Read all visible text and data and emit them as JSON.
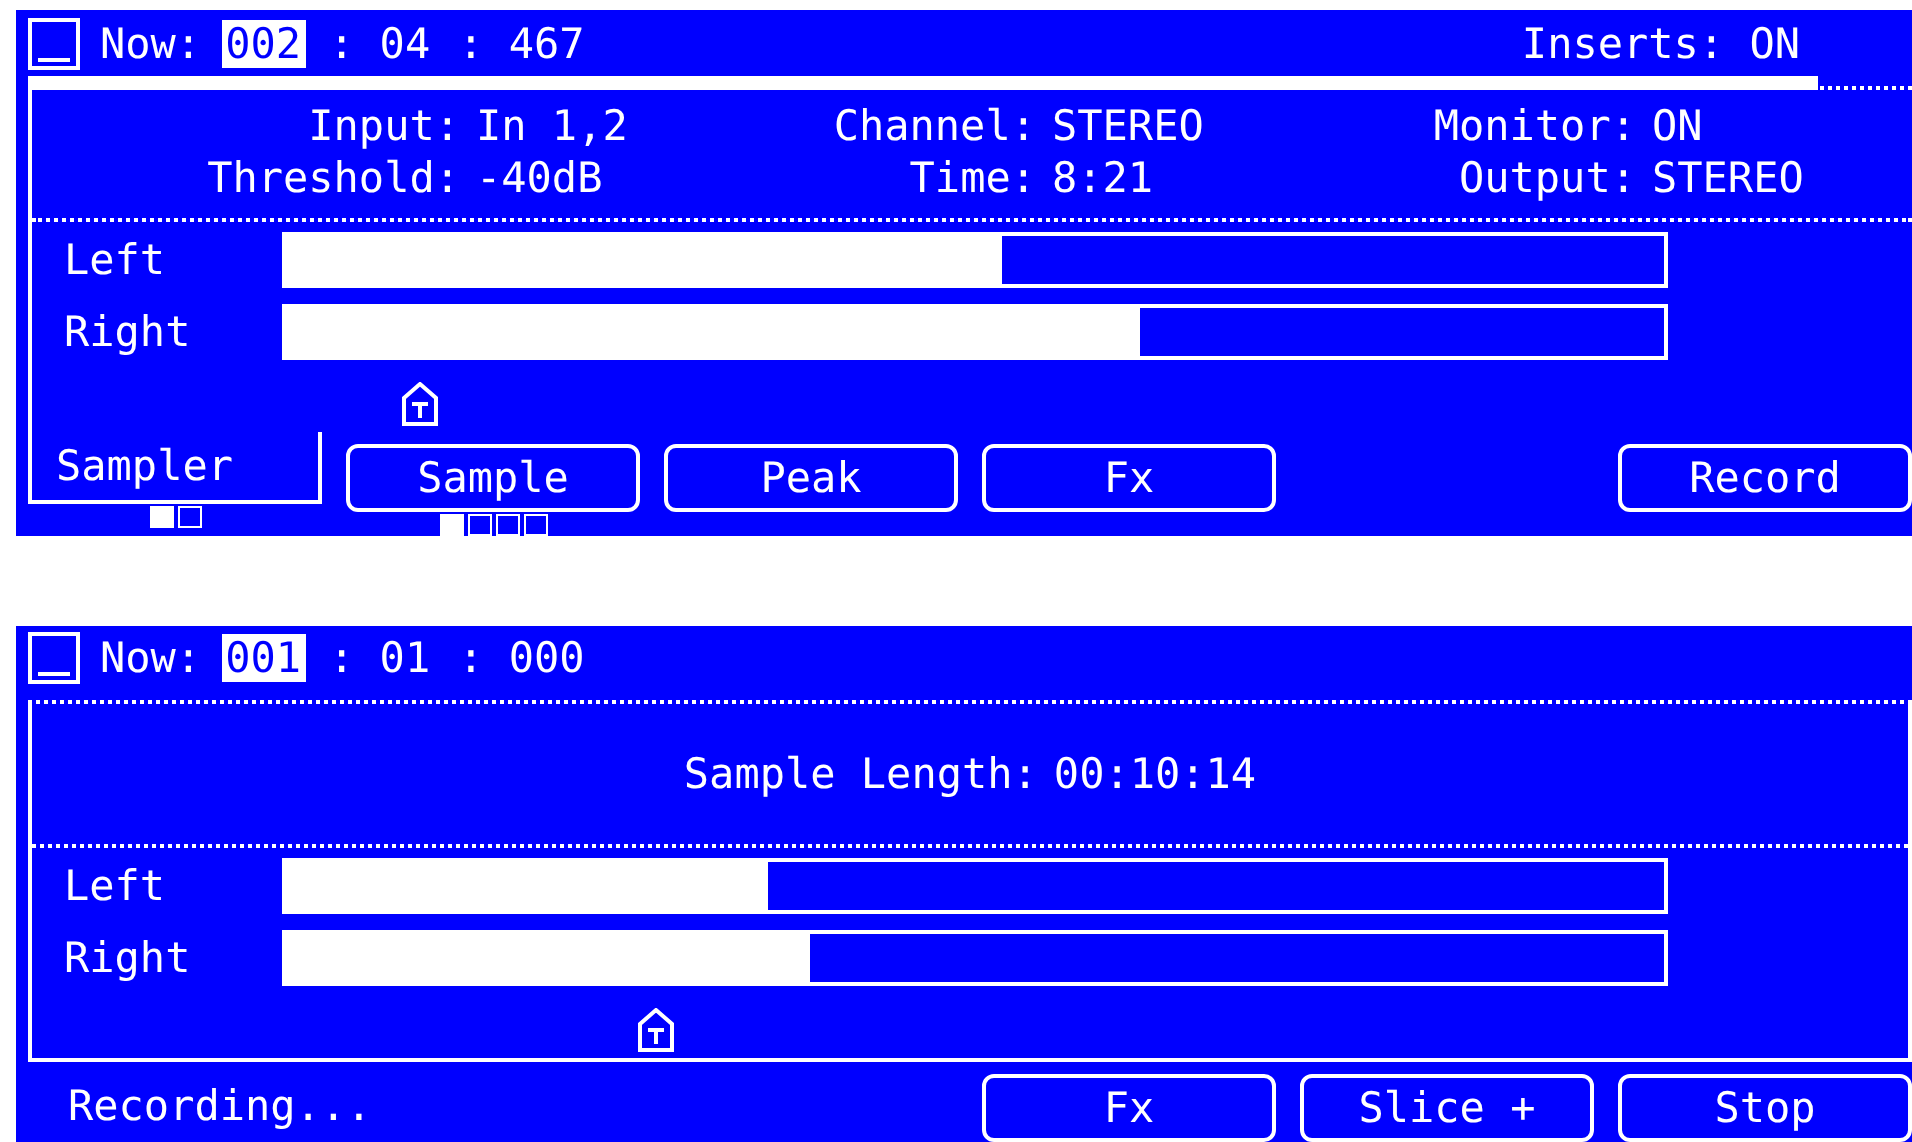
{
  "screens": [
    {
      "header": {
        "label": "Now:",
        "segments": [
          {
            "text": "002",
            "selected": true
          },
          {
            "text": ": 04",
            "selected": false
          },
          {
            "text": ": 467",
            "selected": false
          }
        ],
        "inserts": "Inserts: ON"
      },
      "progress": {
        "level": 0.95
      },
      "info": {
        "kind": "grid",
        "items": [
          {
            "label": "Input:",
            "value": "In 1,2"
          },
          {
            "label": "Channel:",
            "value": "STEREO"
          },
          {
            "label": "Monitor:",
            "value": "ON"
          },
          {
            "label": "Threshold:",
            "value": "-40dB"
          },
          {
            "label": "Time:",
            "value": "8:21"
          },
          {
            "label": "Output:",
            "value": "STEREO"
          }
        ]
      },
      "meters": [
        {
          "name": "Left",
          "level": 0.52
        },
        {
          "name": "Right",
          "level": 0.62
        }
      ],
      "threshold": {
        "level": 0.1
      },
      "footer": {
        "kind": "tab",
        "tab": {
          "label": "Sampler",
          "pages": [
            {
              "selected": true
            },
            {
              "selected": false
            }
          ]
        },
        "buttons": [
          {
            "kind": "button",
            "label": "Sample",
            "pages": [
              {
                "selected": true
              },
              {
                "selected": false
              },
              {
                "selected": false
              },
              {
                "selected": false
              }
            ]
          },
          {
            "kind": "button",
            "label": "Peak"
          },
          {
            "kind": "button",
            "label": "Fx"
          },
          {
            "kind": "blank"
          },
          {
            "kind": "button",
            "label": "Record"
          }
        ]
      }
    },
    {
      "header": {
        "label": "Now:",
        "segments": [
          {
            "text": "001",
            "selected": true
          },
          {
            "text": ": 01",
            "selected": false
          },
          {
            "text": ": 000",
            "selected": false
          }
        ]
      },
      "info": {
        "kind": "single",
        "items": [
          {
            "label": "Sample Length:",
            "value": "00:10:14"
          }
        ]
      },
      "meters": [
        {
          "name": "Left",
          "level": 0.35
        },
        {
          "name": "Right",
          "level": 0.38
        }
      ],
      "threshold": {
        "level": 0.27
      },
      "footer": {
        "kind": "status",
        "status": "Recording...",
        "buttons": [
          {
            "kind": "button",
            "label": "Fx"
          },
          {
            "kind": "button",
            "label": "Slice +"
          },
          {
            "kind": "button",
            "label": "Stop"
          }
        ]
      }
    }
  ]
}
